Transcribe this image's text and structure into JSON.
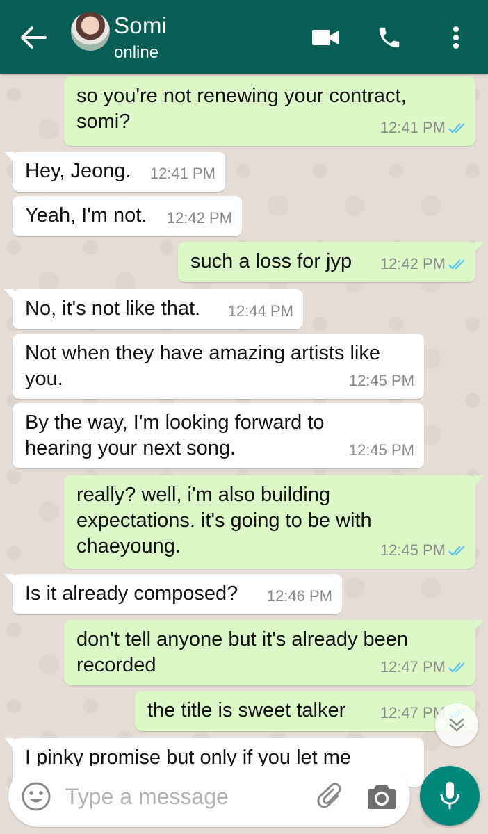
{
  "header": {
    "contact_name": "Somi",
    "status": "online",
    "icons": [
      "back-arrow-icon",
      "avatar",
      "video-call-icon",
      "phone-icon",
      "more-options-icon"
    ],
    "color": "#075e54"
  },
  "messages": [
    {
      "dir": "out",
      "text_lines": [
        "so you're not renewing your contract,",
        "somi?"
      ],
      "time": "12:41 PM",
      "read": true
    },
    {
      "dir": "in",
      "text": "Hey, Jeong.",
      "time": "12:41 PM"
    },
    {
      "dir": "in",
      "text": "Yeah, I'm not.",
      "time": "12:42 PM"
    },
    {
      "dir": "out",
      "text": "such a loss for jyp",
      "time": "12:42 PM",
      "read": true
    },
    {
      "dir": "in",
      "text": "No, it's not like that.",
      "time": "12:44 PM"
    },
    {
      "dir": "in",
      "text_lines": [
        "Not when they have amazing artists like",
        "you."
      ],
      "time": "12:45 PM"
    },
    {
      "dir": "in",
      "text_lines": [
        "By the way, I'm looking forward to",
        "hearing your next song."
      ],
      "time": "12:45 PM"
    },
    {
      "dir": "out",
      "text_lines": [
        "really? well, i'm also building",
        "expectations. it's going to be with",
        "chaeyoung."
      ],
      "time": "12:45 PM",
      "read": true
    },
    {
      "dir": "in",
      "text": "Is it already composed?",
      "time": "12:46 PM"
    },
    {
      "dir": "out",
      "text_lines": [
        "don't tell anyone but it's already been",
        "recorded"
      ],
      "time": "12:47 PM",
      "read": true
    },
    {
      "dir": "out",
      "text": "the title is sweet talker",
      "time": "12:47 PM",
      "read": true
    },
    {
      "dir": "in",
      "text": "I pinky promise but only if you let me",
      "partial": true
    }
  ],
  "composer": {
    "placeholder": "Type a message",
    "value": ""
  },
  "colors": {
    "incoming_bubble": "#ffffff",
    "outgoing_bubble": "#dcf8c6",
    "read_tick": "#4fc3f7",
    "mic_button": "#00897b"
  }
}
